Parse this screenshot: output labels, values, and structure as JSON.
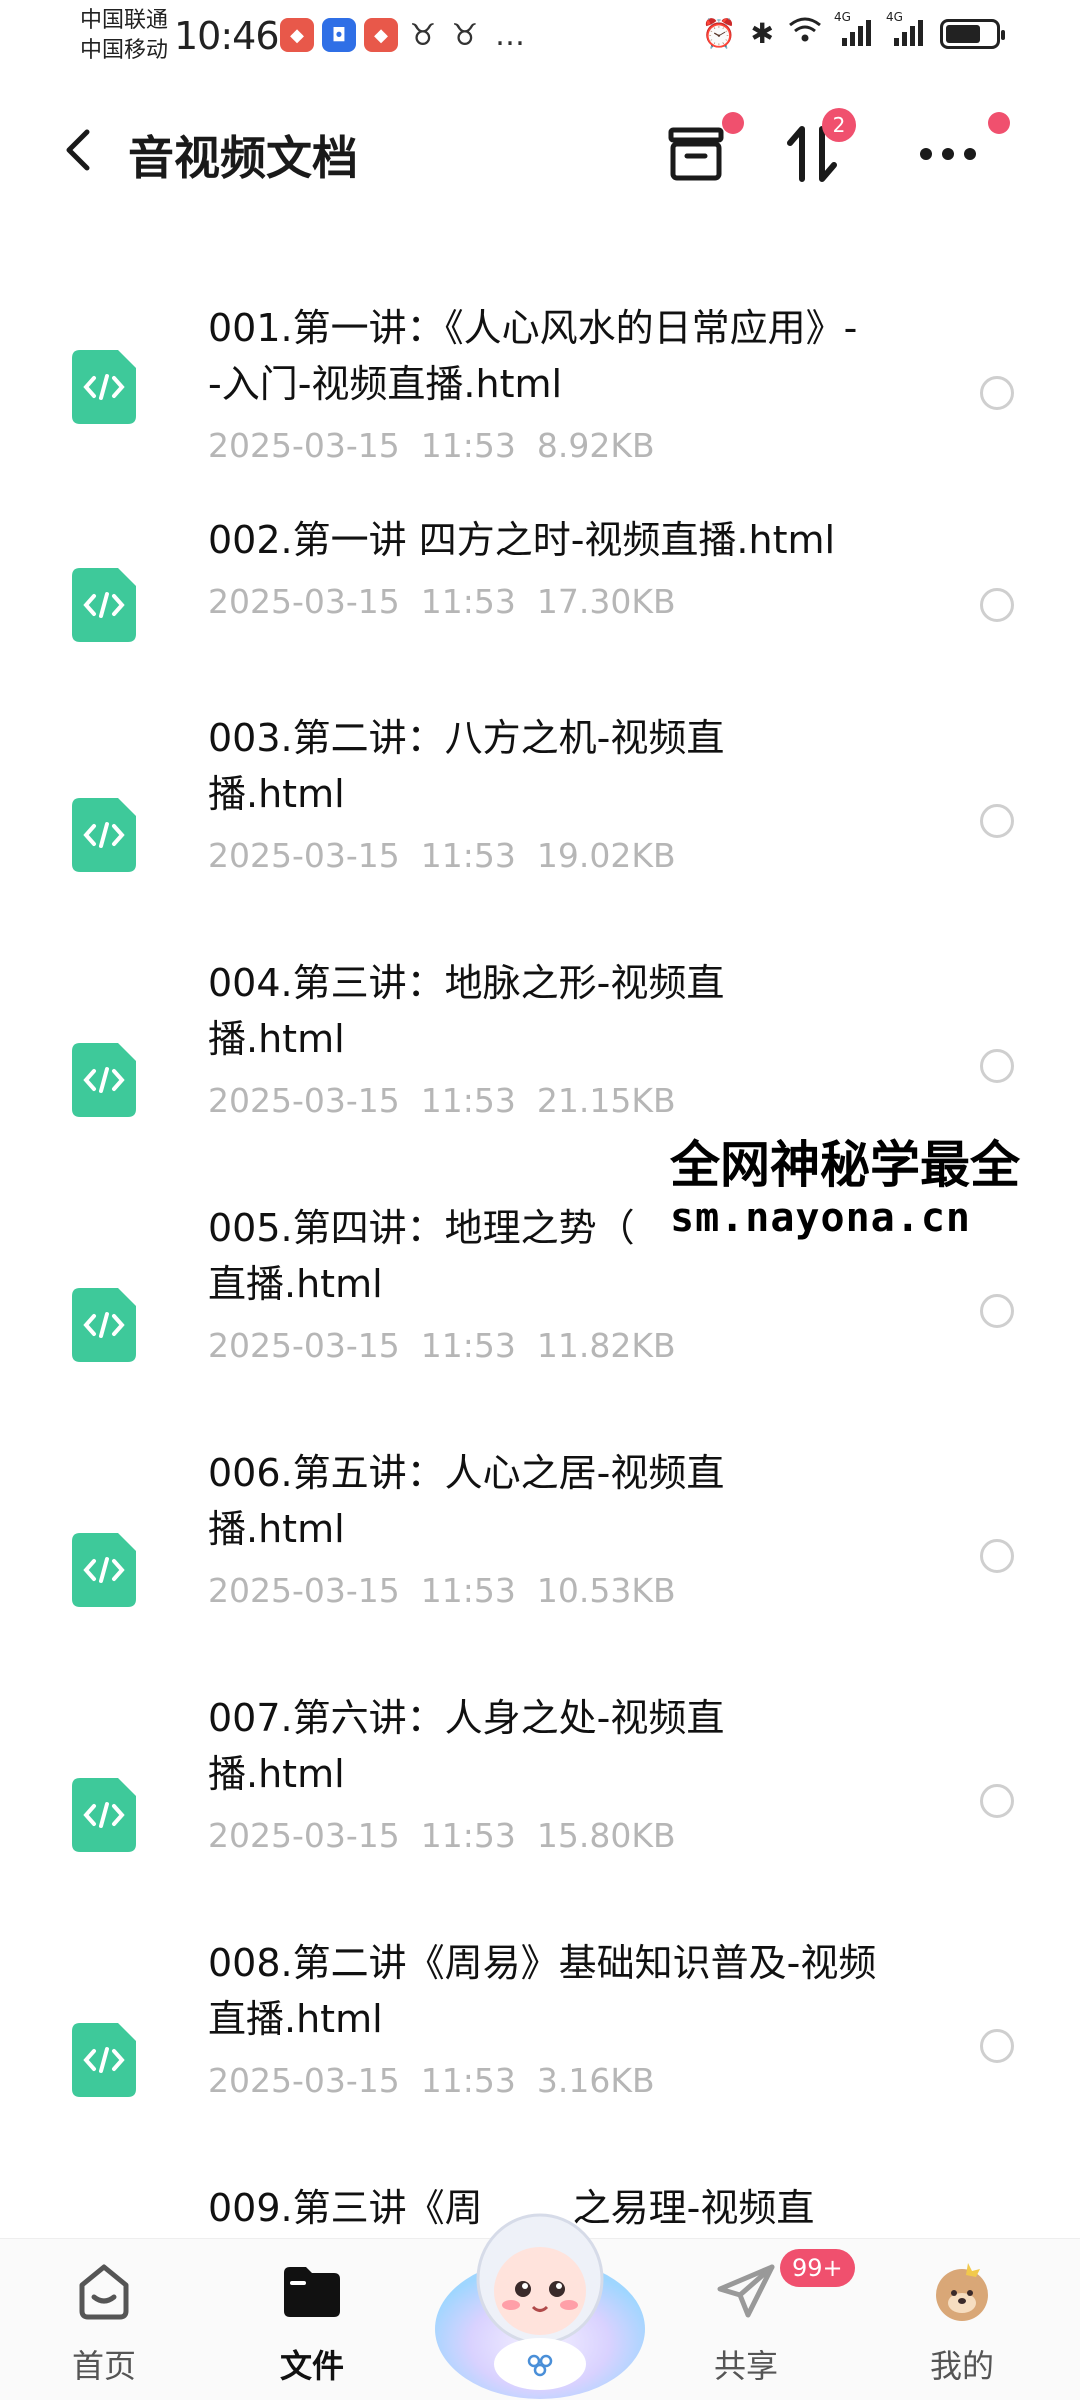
{
  "status_bar": {
    "carrier_1": "中国联通",
    "carrier_2": "中国移动",
    "time": "10:46",
    "net_1": "4G",
    "net_2": "4G"
  },
  "header": {
    "title": "音视频文档",
    "sort_badge": "2"
  },
  "files": [
    {
      "name": "001.第一讲：《人心风水的日常应用》--入门-视频直播.html",
      "date": "2025-03-15",
      "time": "11:53",
      "size": "8.92KB"
    },
    {
      "name": "002.第一讲 四方之时-视频直播.html",
      "date": "2025-03-15",
      "time": "11:53",
      "size": "17.30KB"
    },
    {
      "name": "003.第二讲：八方之机-视频直播.html",
      "date": "2025-03-15",
      "time": "11:53",
      "size": "19.02KB"
    },
    {
      "name": "004.第三讲：地脉之形-视频直播.html",
      "date": "2025-03-15",
      "time": "11:53",
      "size": "21.15KB"
    },
    {
      "name": "005.第四讲：地理之势（",
      "name_line2": "直播.html",
      "date": "2025-03-15",
      "time": "11:53",
      "size": "11.82KB"
    },
    {
      "name": "006.第五讲：人心之居-视频直播.html",
      "date": "2025-03-15",
      "time": "11:53",
      "size": "10.53KB"
    },
    {
      "name": "007.第六讲：人身之处-视频直播.html",
      "date": "2025-03-15",
      "time": "11:53",
      "size": "15.80KB"
    },
    {
      "name": "008.第二讲《周易》基础知识普及-视频直播.html",
      "date": "2025-03-15",
      "time": "11:53",
      "size": "3.16KB"
    },
    {
      "name": "009.第三讲《周",
      "name_suffix": "之易理-视频直",
      "date": "",
      "time": "",
      "size": ""
    }
  ],
  "overlay": {
    "line1": "全网神秘学最全",
    "line2": "sm.nayona.cn"
  },
  "bottom_nav": {
    "home": "首页",
    "files": "文件",
    "share": "共享",
    "share_badge": "99+",
    "mine": "我的"
  },
  "colors": {
    "accent": "#3ec99a",
    "badge": "#f0506e",
    "meta_text": "#b6b6b6"
  },
  "icons": {
    "back": "chevron-left-icon",
    "archive": "archive-icon",
    "sort": "sort-icon",
    "more": "more-icon",
    "file": "code-file-icon"
  }
}
